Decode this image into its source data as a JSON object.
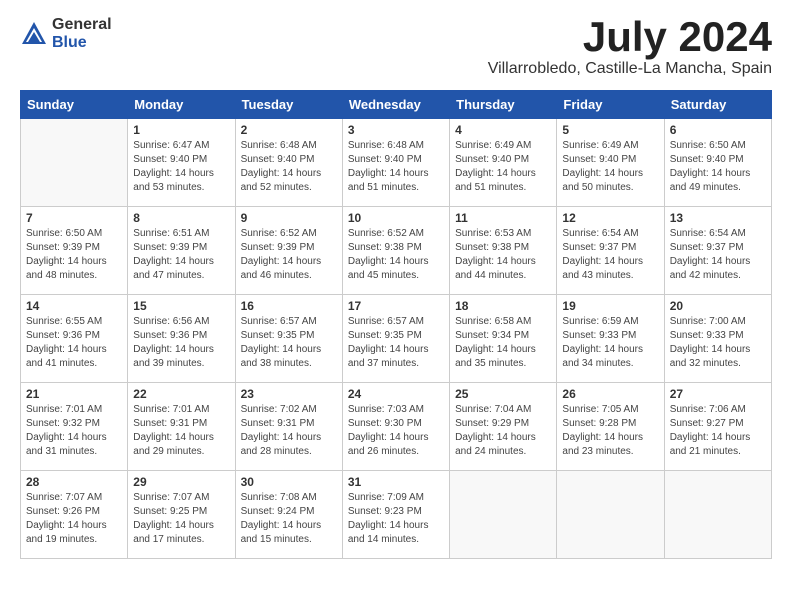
{
  "header": {
    "logo_general": "General",
    "logo_blue": "Blue",
    "month_title": "July 2024",
    "location": "Villarrobledo, Castille-La Mancha, Spain"
  },
  "days_of_week": [
    "Sunday",
    "Monday",
    "Tuesday",
    "Wednesday",
    "Thursday",
    "Friday",
    "Saturday"
  ],
  "weeks": [
    [
      {
        "day": "",
        "info": ""
      },
      {
        "day": "1",
        "info": "Sunrise: 6:47 AM\nSunset: 9:40 PM\nDaylight: 14 hours\nand 53 minutes."
      },
      {
        "day": "2",
        "info": "Sunrise: 6:48 AM\nSunset: 9:40 PM\nDaylight: 14 hours\nand 52 minutes."
      },
      {
        "day": "3",
        "info": "Sunrise: 6:48 AM\nSunset: 9:40 PM\nDaylight: 14 hours\nand 51 minutes."
      },
      {
        "day": "4",
        "info": "Sunrise: 6:49 AM\nSunset: 9:40 PM\nDaylight: 14 hours\nand 51 minutes."
      },
      {
        "day": "5",
        "info": "Sunrise: 6:49 AM\nSunset: 9:40 PM\nDaylight: 14 hours\nand 50 minutes."
      },
      {
        "day": "6",
        "info": "Sunrise: 6:50 AM\nSunset: 9:40 PM\nDaylight: 14 hours\nand 49 minutes."
      }
    ],
    [
      {
        "day": "7",
        "info": "Sunrise: 6:50 AM\nSunset: 9:39 PM\nDaylight: 14 hours\nand 48 minutes."
      },
      {
        "day": "8",
        "info": "Sunrise: 6:51 AM\nSunset: 9:39 PM\nDaylight: 14 hours\nand 47 minutes."
      },
      {
        "day": "9",
        "info": "Sunrise: 6:52 AM\nSunset: 9:39 PM\nDaylight: 14 hours\nand 46 minutes."
      },
      {
        "day": "10",
        "info": "Sunrise: 6:52 AM\nSunset: 9:38 PM\nDaylight: 14 hours\nand 45 minutes."
      },
      {
        "day": "11",
        "info": "Sunrise: 6:53 AM\nSunset: 9:38 PM\nDaylight: 14 hours\nand 44 minutes."
      },
      {
        "day": "12",
        "info": "Sunrise: 6:54 AM\nSunset: 9:37 PM\nDaylight: 14 hours\nand 43 minutes."
      },
      {
        "day": "13",
        "info": "Sunrise: 6:54 AM\nSunset: 9:37 PM\nDaylight: 14 hours\nand 42 minutes."
      }
    ],
    [
      {
        "day": "14",
        "info": "Sunrise: 6:55 AM\nSunset: 9:36 PM\nDaylight: 14 hours\nand 41 minutes."
      },
      {
        "day": "15",
        "info": "Sunrise: 6:56 AM\nSunset: 9:36 PM\nDaylight: 14 hours\nand 39 minutes."
      },
      {
        "day": "16",
        "info": "Sunrise: 6:57 AM\nSunset: 9:35 PM\nDaylight: 14 hours\nand 38 minutes."
      },
      {
        "day": "17",
        "info": "Sunrise: 6:57 AM\nSunset: 9:35 PM\nDaylight: 14 hours\nand 37 minutes."
      },
      {
        "day": "18",
        "info": "Sunrise: 6:58 AM\nSunset: 9:34 PM\nDaylight: 14 hours\nand 35 minutes."
      },
      {
        "day": "19",
        "info": "Sunrise: 6:59 AM\nSunset: 9:33 PM\nDaylight: 14 hours\nand 34 minutes."
      },
      {
        "day": "20",
        "info": "Sunrise: 7:00 AM\nSunset: 9:33 PM\nDaylight: 14 hours\nand 32 minutes."
      }
    ],
    [
      {
        "day": "21",
        "info": "Sunrise: 7:01 AM\nSunset: 9:32 PM\nDaylight: 14 hours\nand 31 minutes."
      },
      {
        "day": "22",
        "info": "Sunrise: 7:01 AM\nSunset: 9:31 PM\nDaylight: 14 hours\nand 29 minutes."
      },
      {
        "day": "23",
        "info": "Sunrise: 7:02 AM\nSunset: 9:31 PM\nDaylight: 14 hours\nand 28 minutes."
      },
      {
        "day": "24",
        "info": "Sunrise: 7:03 AM\nSunset: 9:30 PM\nDaylight: 14 hours\nand 26 minutes."
      },
      {
        "day": "25",
        "info": "Sunrise: 7:04 AM\nSunset: 9:29 PM\nDaylight: 14 hours\nand 24 minutes."
      },
      {
        "day": "26",
        "info": "Sunrise: 7:05 AM\nSunset: 9:28 PM\nDaylight: 14 hours\nand 23 minutes."
      },
      {
        "day": "27",
        "info": "Sunrise: 7:06 AM\nSunset: 9:27 PM\nDaylight: 14 hours\nand 21 minutes."
      }
    ],
    [
      {
        "day": "28",
        "info": "Sunrise: 7:07 AM\nSunset: 9:26 PM\nDaylight: 14 hours\nand 19 minutes."
      },
      {
        "day": "29",
        "info": "Sunrise: 7:07 AM\nSunset: 9:25 PM\nDaylight: 14 hours\nand 17 minutes."
      },
      {
        "day": "30",
        "info": "Sunrise: 7:08 AM\nSunset: 9:24 PM\nDaylight: 14 hours\nand 15 minutes."
      },
      {
        "day": "31",
        "info": "Sunrise: 7:09 AM\nSunset: 9:23 PM\nDaylight: 14 hours\nand 14 minutes."
      },
      {
        "day": "",
        "info": ""
      },
      {
        "day": "",
        "info": ""
      },
      {
        "day": "",
        "info": ""
      }
    ]
  ]
}
